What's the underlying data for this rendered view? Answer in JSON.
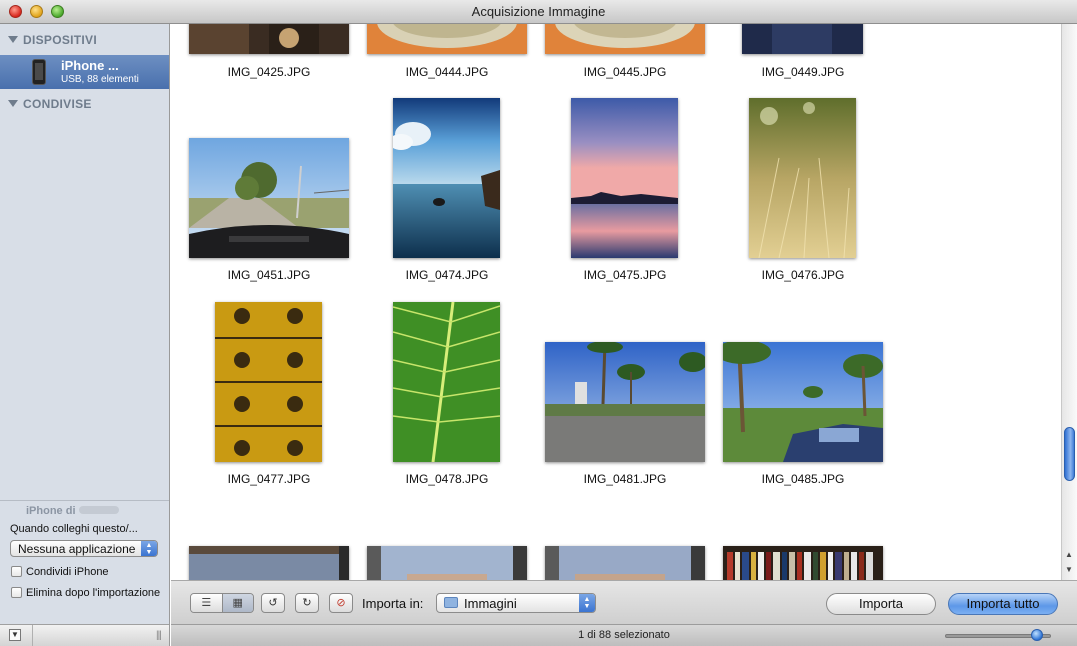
{
  "window": {
    "title": "Acquisizione Immagine"
  },
  "sidebar": {
    "devices_header": "DISPOSITIVI",
    "shared_header": "CONDIVISE",
    "device": {
      "name": "iPhone ...",
      "subtitle": "USB, 88 elementi"
    },
    "owner_label": "iPhone di",
    "when_connect_label": "Quando colleghi questo/...",
    "app_popup_value": "Nessuna applicazione",
    "share_checkbox_label": "Condividi iPhone",
    "delete_checkbox_label": "Elimina dopo l'importazione"
  },
  "images": [
    {
      "label": "IMG_0425.JPG"
    },
    {
      "label": "IMG_0444.JPG"
    },
    {
      "label": "IMG_0445.JPG"
    },
    {
      "label": "IMG_0449.JPG"
    },
    {
      "label": "IMG_0451.JPG"
    },
    {
      "label": "IMG_0474.JPG"
    },
    {
      "label": "IMG_0475.JPG"
    },
    {
      "label": "IMG_0476.JPG"
    },
    {
      "label": "IMG_0477.JPG"
    },
    {
      "label": "IMG_0478.JPG"
    },
    {
      "label": "IMG_0481.JPG"
    },
    {
      "label": "IMG_0485.JPG"
    }
  ],
  "toolbar": {
    "import_in_label": "Importa in:",
    "destination_value": "Immagini",
    "import_button": "Importa",
    "import_all_button": "Importa tutto"
  },
  "status": {
    "text": "1 di 88 selezionato",
    "zoom_level": 0.92
  },
  "colors": {
    "selection": "#4970ad",
    "sidebar_bg": "#d8dee7",
    "primary_button": "#5d98e8"
  }
}
